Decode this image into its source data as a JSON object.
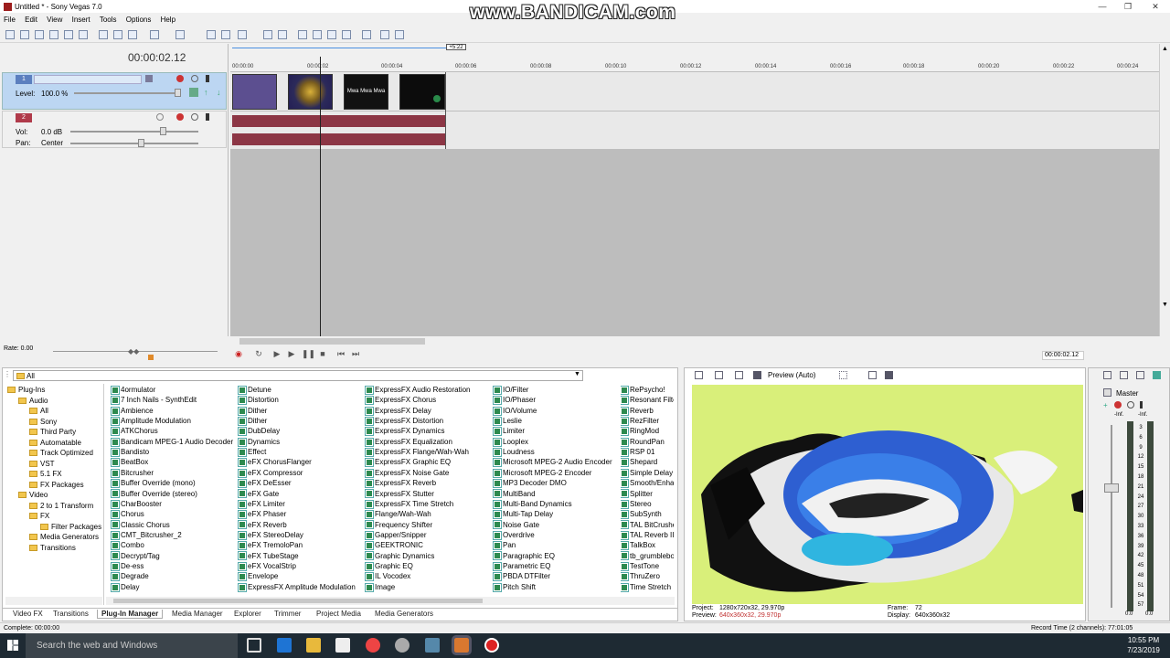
{
  "window": {
    "title": "Untitled * - Sony Vegas 7.0",
    "watermark": "www.BANDICAM.com"
  },
  "menu": [
    "File",
    "Edit",
    "View",
    "Insert",
    "Tools",
    "Options",
    "Help"
  ],
  "timeline": {
    "timecode": "00:00:02.12",
    "end_marker": "+5:22",
    "ruler": [
      "00:00:00",
      "00:00:02",
      "00:00:04",
      "00:00:06",
      "00:00:08",
      "00:00:10",
      "00:00:12",
      "00:00:14",
      "00:00:16",
      "00:00:18",
      "00:00:20",
      "00:00:22",
      "00:00:24"
    ],
    "video_track": {
      "number": "1",
      "level_label": "Level:",
      "level_value": "100.0 %"
    },
    "audio_track": {
      "number": "2",
      "vol_label": "Vol:",
      "vol_value": "0.0 dB",
      "pan_label": "Pan:",
      "pan_value": "Center"
    },
    "clip_texts": [
      "",
      "",
      "Mwa Mwa Mwa",
      ""
    ]
  },
  "transport": {
    "rate": "Rate: 0.00",
    "timecode": "00:00:02.12"
  },
  "plugins": {
    "filter": "All",
    "tree": [
      {
        "label": "Plug-Ins",
        "level": 0
      },
      {
        "label": "Audio",
        "level": 1
      },
      {
        "label": "All",
        "level": 2
      },
      {
        "label": "Sony",
        "level": 2
      },
      {
        "label": "Third Party",
        "level": 2
      },
      {
        "label": "Automatable",
        "level": 2
      },
      {
        "label": "Track Optimized",
        "level": 2
      },
      {
        "label": "VST",
        "level": 2
      },
      {
        "label": "5.1 FX",
        "level": 2
      },
      {
        "label": "FX Packages",
        "level": 2
      },
      {
        "label": "Video",
        "level": 1
      },
      {
        "label": "2 to 1 Transform",
        "level": 2
      },
      {
        "label": "FX",
        "level": 2
      },
      {
        "label": "Filter Packages",
        "level": 3
      },
      {
        "label": "Media Generators",
        "level": 2
      },
      {
        "label": "Transitions",
        "level": 2
      }
    ],
    "columns": [
      [
        "4ormulator",
        "7 Inch Nails - SynthEdit",
        "Ambience",
        "Amplitude Modulation",
        "ATKChorus",
        "Bandicam MPEG-1 Audio Decoder",
        "Bandisto",
        "BeatBox",
        "Bitcrusher",
        "Buffer Override (mono)",
        "Buffer Override (stereo)",
        "CharBooster",
        "Chorus",
        "Classic Chorus",
        "CMT_Bitcrusher_2",
        "Combo",
        "Decrypt/Tag",
        "De-ess",
        "Degrade",
        "Delay"
      ],
      [
        "Detune",
        "Distortion",
        "Dither",
        "Dither",
        "DubDelay",
        "Dynamics",
        "Effect",
        "eFX ChorusFlanger",
        "eFX Compressor",
        "eFX DeEsser",
        "eFX Gate",
        "eFX Limiter",
        "eFX Phaser",
        "eFX Reverb",
        "eFX StereoDelay",
        "eFX TremoloPan",
        "eFX TubeStage",
        "eFX VocalStrip",
        "Envelope",
        "ExpressFX Amplitude Modulation"
      ],
      [
        "ExpressFX Audio Restoration",
        "ExpressFX Chorus",
        "ExpressFX Delay",
        "ExpressFX Distortion",
        "ExpressFX Dynamics",
        "ExpressFX Equalization",
        "ExpressFX Flange/Wah-Wah",
        "ExpressFX Graphic EQ",
        "ExpressFX Noise Gate",
        "ExpressFX Reverb",
        "ExpressFX Stutter",
        "ExpressFX Time Stretch",
        "Flange/Wah-Wah",
        "Frequency Shifter",
        "Gapper/Snipper",
        "GEEKTRONIC",
        "Graphic Dynamics",
        "Graphic EQ",
        "IL Vocodex",
        "Image"
      ],
      [
        "IO/Filter",
        "IO/Phaser",
        "IO/Volume",
        "Leslie",
        "Limiter",
        "Looplex",
        "Loudness",
        "Microsoft MPEG-2 Audio Encoder",
        "Microsoft MPEG-2 Encoder",
        "MP3 Decoder DMO",
        "MultiBand",
        "Multi-Band Dynamics",
        "Multi-Tap Delay",
        "Noise Gate",
        "Overdrive",
        "Pan",
        "Paragraphic EQ",
        "Parametric EQ",
        "PBDA DTFilter",
        "Pitch Shift"
      ],
      [
        "RePsycho!",
        "Resonant Filter",
        "Reverb",
        "RezFilter",
        "RingMod",
        "RoundPan",
        "RSP 01",
        "Shepard",
        "Simple Delay",
        "Smooth/Enhance",
        "Splitter",
        "Stereo",
        "SubSynth",
        "TAL BitCrusher",
        "TAL Reverb II",
        "TalkBox",
        "tb_grumblebox",
        "TestTone",
        "ThruZero",
        "Time Stretch"
      ]
    ],
    "tabs": [
      "Video FX",
      "Transitions",
      "Plug-In Manager",
      "Media Manager",
      "Explorer",
      "Trimmer",
      "Project Media",
      "Media Generators"
    ]
  },
  "preview": {
    "mode": "Preview (Auto)",
    "project_label": "Project:",
    "project_value": "1280x720x32, 29.970p",
    "preview_label": "Preview:",
    "preview_value": "640x360x32, 29.970p",
    "frame_label": "Frame:",
    "frame_value": "72",
    "display_label": "Display:",
    "display_value": "640x360x32"
  },
  "mixer": {
    "title": "Master",
    "peak_left": "-Inf.",
    "peak_right": "-Inf.",
    "scale": [
      "3",
      "6",
      "9",
      "12",
      "15",
      "18",
      "21",
      "24",
      "27",
      "30",
      "33",
      "36",
      "39",
      "42",
      "45",
      "48",
      "51",
      "54",
      "57"
    ],
    "bottom_left": "0.0",
    "bottom_right": "0.0"
  },
  "status": {
    "left": "Complete: 00:00:00",
    "right": "Record Time (2 channels): 77:01:05"
  },
  "taskbar": {
    "search": "Search the web and Windows",
    "time": "10:55 PM",
    "date": "7/23/2019"
  },
  "colors": {
    "audio_wave": "#8c3645",
    "video_track_bg": "#bcd6f2",
    "preview_bg": "#d9ef7a"
  }
}
